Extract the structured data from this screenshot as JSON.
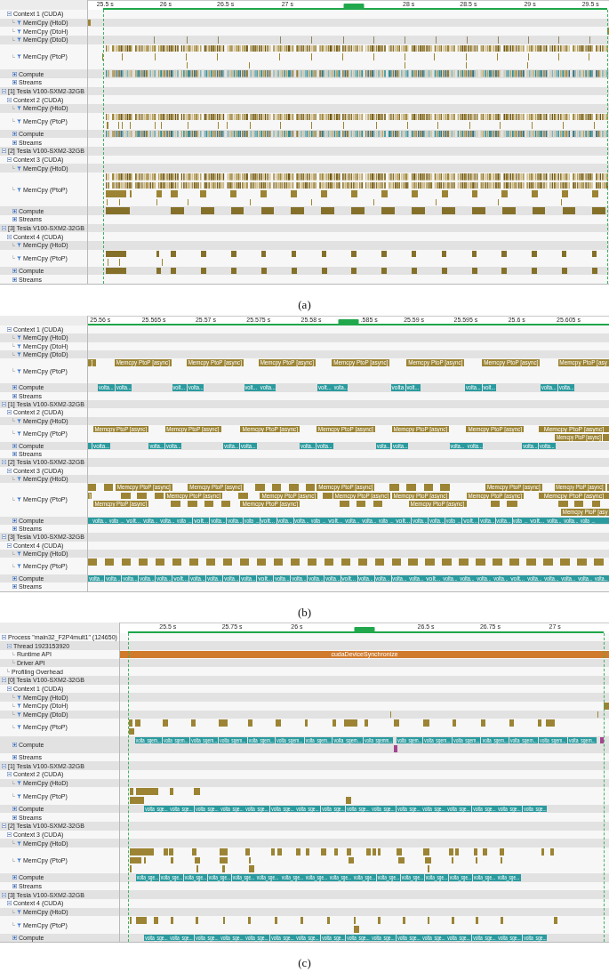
{
  "panels": [
    {
      "caption": "(a)",
      "ticks": [
        "25.5 s",
        "26 s",
        "26.5 s",
        "27 s",
        "28 s",
        "28.5 s",
        "29 s",
        "29.5 s"
      ],
      "rows": [
        {
          "label": "Context 1 (CUDA)",
          "kind": "context",
          "expanded": true,
          "children": [
            {
              "label": "MemCpy (HtoD)",
              "kind": "memcpy"
            },
            {
              "label": "MemCpy (DtoH)",
              "kind": "memcpy"
            },
            {
              "label": "MemCpy (DtoD)",
              "kind": "memcpy"
            },
            {
              "label": "MemCpy (PtoP)",
              "kind": "memcpy"
            },
            {
              "label": "Compute",
              "kind": "compute",
              "expanded": false
            },
            {
              "label": "Streams",
              "kind": "streams",
              "expanded": false
            }
          ]
        },
        {
          "label": "[1] Tesla V100-SXM2-32GB",
          "kind": "device",
          "expanded": true,
          "children": [
            {
              "label": "Context 2 (CUDA)",
              "kind": "context",
              "expanded": true,
              "children": [
                {
                  "label": "MemCpy (HtoD)",
                  "kind": "memcpy"
                },
                {
                  "label": "MemCpy (PtoP)",
                  "kind": "memcpy"
                },
                {
                  "label": "Compute",
                  "kind": "compute",
                  "expanded": false
                },
                {
                  "label": "Streams",
                  "kind": "streams",
                  "expanded": false
                }
              ]
            }
          ]
        },
        {
          "label": "[2] Tesla V100-SXM2-32GB",
          "kind": "device",
          "expanded": true,
          "children": [
            {
              "label": "Context 3 (CUDA)",
              "kind": "context",
              "expanded": true,
              "children": [
                {
                  "label": "MemCpy (HtoD)",
                  "kind": "memcpy"
                },
                {
                  "label": "MemCpy (PtoP)",
                  "kind": "memcpy"
                },
                {
                  "label": "Compute",
                  "kind": "compute",
                  "expanded": false
                },
                {
                  "label": "Streams",
                  "kind": "streams",
                  "expanded": false
                }
              ]
            }
          ]
        },
        {
          "label": "[3] Tesla V100-SXM2-32GB",
          "kind": "device",
          "expanded": true,
          "children": [
            {
              "label": "Context 4 (CUDA)",
              "kind": "context",
              "expanded": true,
              "children": [
                {
                  "label": "MemCpy (HtoD)",
                  "kind": "memcpy"
                },
                {
                  "label": "MemCpy (PtoP)",
                  "kind": "memcpy"
                },
                {
                  "label": "Compute",
                  "kind": "compute",
                  "expanded": false
                },
                {
                  "label": "Streams",
                  "kind": "streams",
                  "expanded": false
                }
              ]
            }
          ]
        }
      ]
    },
    {
      "caption": "(b)",
      "ticks": [
        "25.56 s",
        "25.565 s",
        "25.57 s",
        "25.575 s",
        "25.58 s",
        ".585 s",
        "25.59 s",
        "25.595 s",
        "25.6 s",
        "25.605 s"
      ],
      "rows": [
        {
          "label": "Context 1 (CUDA)",
          "kind": "context",
          "expanded": true,
          "children": [
            {
              "label": "MemCpy (HtoD)",
              "kind": "memcpy"
            },
            {
              "label": "MemCpy (DtoH)",
              "kind": "memcpy"
            },
            {
              "label": "MemCpy (DtoD)",
              "kind": "memcpy"
            },
            {
              "label": "MemCpy (PtoP)",
              "kind": "memcpy",
              "bar_labels": [
                "]",
                "Memcpy PtoP [async]",
                "Memcpy PtoP [async]",
                "Memcpy PtoP [async]",
                "Memcpy PtoP [async]",
                "Memcpy PtoP [async]",
                "Memcpy PtoP [async]",
                "Memcpy PtoP [asy"
              ]
            },
            {
              "label": "Compute",
              "kind": "compute",
              "expanded": false,
              "bar_labels": [
                "volta...",
                "volta...",
                "volt...",
                "volta...",
                "volt...",
                "volta...",
                "volt...",
                "volta...",
                "volta",
                "volt...",
                "volta...",
                "volt...",
                "volta...",
                "volta..."
              ]
            },
            {
              "label": "Streams",
              "kind": "streams",
              "expanded": false
            }
          ]
        },
        {
          "label": "[1] Tesla V100-SXM2-32GB",
          "kind": "device",
          "expanded": true,
          "children": [
            {
              "label": "Context 2 (CUDA)",
              "kind": "context",
              "expanded": true,
              "children": [
                {
                  "label": "MemCpy (HtoD)",
                  "kind": "memcpy"
                },
                {
                  "label": "MemCpy (PtoP)",
                  "kind": "memcpy",
                  "bar_labels": [
                    "Memcpy PtoP [async]",
                    "Memcpy PtoP [async]",
                    "Memcpy PtoP [async]",
                    "Memcpy PtoP [async]",
                    "Memcpy PtoP [async]",
                    "Memcpy PtoP [async]",
                    "Memcpy PtoP [async]",
                    "Memcpy PtoP [async]"
                  ]
                },
                {
                  "label": "Compute",
                  "kind": "compute",
                  "expanded": false,
                  "bar_labels": [
                    "volta...",
                    "volta...",
                    "volta...",
                    "volta...",
                    "volta...",
                    "volta...",
                    "volta...",
                    "volta...",
                    "volta...",
                    "volta...",
                    "volta...",
                    "volta...",
                    "volta..."
                  ]
                },
                {
                  "label": "Streams",
                  "kind": "streams",
                  "expanded": false
                }
              ]
            }
          ]
        },
        {
          "label": "[2] Tesla V100-SXM2-32GB",
          "kind": "device",
          "expanded": true,
          "children": [
            {
              "label": "Context 3 (CUDA)",
              "kind": "context",
              "expanded": true,
              "children": [
                {
                  "label": "MemCpy (HtoD)",
                  "kind": "memcpy"
                },
                {
                  "label": "MemCpy (PtoP)",
                  "kind": "memcpy",
                  "bar_labels": [
                    "Memcpy PtoP [async]",
                    "Memcpy PtoP [async]",
                    "Memcpy PtoP [async]",
                    "Memcpy PtoP [async]",
                    "Memcpy PtoP [async]",
                    "]",
                    "Memcpy PtoP [async]",
                    "Memcpy PtoP [async]",
                    "Memcpy PtoP [async]",
                    "Memcpy PtoP [async]",
                    "Memcpy PtoP [async]",
                    "Memcpy PtoP [async]",
                    "Memcpy PtoP [async]",
                    "Memcpy PtoP [async]",
                    "Memcpy PtoP [async]",
                    "Memcpy PtoP [asy"
                  ]
                },
                {
                  "label": "Compute",
                  "kind": "compute",
                  "expanded": false,
                  "bar_labels": [
                    "volta...",
                    "volta_...",
                    "volt...",
                    "volta...",
                    "volta...",
                    "volta_...",
                    "volt...",
                    "volta...",
                    "volta...",
                    "volta_...",
                    "volt...",
                    "volta...",
                    "volta...",
                    "volta_...",
                    "volt...",
                    "volta...",
                    "volta...",
                    "volta_...",
                    "volt...",
                    "volta...",
                    "volta...",
                    "volta_...",
                    "volt...",
                    "volta...",
                    "volta...",
                    "volta_...",
                    "volt...",
                    "volta...",
                    "volta...",
                    "volta_..."
                  ]
                },
                {
                  "label": "Streams",
                  "kind": "streams",
                  "expanded": false
                }
              ]
            }
          ]
        },
        {
          "label": "[3] Tesla V100-SXM2-32GB",
          "kind": "device",
          "expanded": true,
          "children": [
            {
              "label": "Context 4 (CUDA)",
              "kind": "context",
              "expanded": true,
              "children": [
                {
                  "label": "MemCpy (HtoD)",
                  "kind": "memcpy"
                },
                {
                  "label": "MemCpy (PtoP)",
                  "kind": "memcpy"
                },
                {
                  "label": "Compute",
                  "kind": "compute",
                  "expanded": false,
                  "bar_labels": [
                    "volta...",
                    "volta...",
                    "volta...",
                    "volta...",
                    "volta...",
                    "volt...",
                    "volta...",
                    "volta...",
                    "volta...",
                    "volta...",
                    "volt...",
                    "volta...",
                    "volta...",
                    "volta...",
                    "volta...",
                    "volt...",
                    "volta...",
                    "volta...",
                    "volta...",
                    "volta...",
                    "volt...",
                    "volta...",
                    "volta...",
                    "volta...",
                    "volta...",
                    "volt...",
                    "volta...",
                    "volta...",
                    "volta...",
                    "volta...",
                    "volta..."
                  ]
                },
                {
                  "label": "Streams",
                  "kind": "streams",
                  "expanded": false
                }
              ]
            }
          ]
        }
      ]
    },
    {
      "caption": "(c)",
      "ticks": [
        "25.5 s",
        "25.75 s",
        "26 s",
        "26.5 s",
        "26.75 s",
        "27 s"
      ],
      "rows": [
        {
          "label": "Process \"main32_F2P4mult1\" (124650)",
          "kind": "process",
          "expanded": true,
          "children": [
            {
              "label": "Thread 1923153920",
              "kind": "thread",
              "expanded": true,
              "children": [
                {
                  "label": "Runtime API",
                  "kind": "api",
                  "bar_labels": [
                    "cudaDeviceSynchronize"
                  ]
                },
                {
                  "label": "Driver API",
                  "kind": "api"
                }
              ]
            },
            {
              "label": "Profiling Overhead",
              "kind": "overhead"
            }
          ]
        },
        {
          "label": "[0] Tesla V100-SXM2-32GB",
          "kind": "device",
          "expanded": true,
          "children": [
            {
              "label": "Context 1 (CUDA)",
              "kind": "context",
              "expanded": true,
              "children": [
                {
                  "label": "MemCpy (HtoD)",
                  "kind": "memcpy"
                },
                {
                  "label": "MemCpy (DtoH)",
                  "kind": "memcpy"
                },
                {
                  "label": "MemCpy (DtoD)",
                  "kind": "memcpy"
                },
                {
                  "label": "MemCpy (PtoP)",
                  "kind": "memcpy"
                },
                {
                  "label": "Compute",
                  "kind": "compute",
                  "expanded": false,
                  "bar_labels": [
                    "volta_sgem...",
                    "volta_sgem...",
                    "volta_sgem...",
                    "volta_sgem...",
                    "volta_sgem...",
                    "volta_sgem...",
                    "volta_sgem...",
                    "volta_sgem...",
                    "volta_sgemm...",
                    "volta_sgem...",
                    "volta_sgem...",
                    "volta_sgem...",
                    "volta_sgem...",
                    "volta_sgem...",
                    "volta_sgem...",
                    "volta_sgem..."
                  ]
                },
                {
                  "label": "Streams",
                  "kind": "streams",
                  "expanded": false
                }
              ]
            }
          ]
        },
        {
          "label": "[1] Tesla V100-SXM2-32GB",
          "kind": "device",
          "expanded": true,
          "children": [
            {
              "label": "Context 2 (CUDA)",
              "kind": "context",
              "expanded": true,
              "children": [
                {
                  "label": "MemCpy (HtoD)",
                  "kind": "memcpy"
                },
                {
                  "label": "MemCpy (PtoP)",
                  "kind": "memcpy"
                },
                {
                  "label": "Compute",
                  "kind": "compute",
                  "expanded": false,
                  "bar_labels": [
                    "volta_sge...",
                    "volta_sge...",
                    "volta_sge...",
                    "volta_sge...",
                    "volta_sge...",
                    "volta_sge...",
                    "volta_sge...",
                    "volta_sge...",
                    "volta_sge...",
                    "volta_sge...",
                    "volta_sge...",
                    "volta_sge...",
                    "volta_sge...",
                    "volta_sge...",
                    "volta_sge...",
                    "volta_sge..."
                  ]
                },
                {
                  "label": "Streams",
                  "kind": "streams",
                  "expanded": false
                }
              ]
            }
          ]
        },
        {
          "label": "[2] Tesla V100-SXM2-32GB",
          "kind": "device",
          "expanded": true,
          "children": [
            {
              "label": "Context 3 (CUDA)",
              "kind": "context",
              "expanded": true,
              "children": [
                {
                  "label": "MemCpy (HtoD)",
                  "kind": "memcpy"
                },
                {
                  "label": "MemCpy (PtoP)",
                  "kind": "memcpy"
                },
                {
                  "label": "Compute",
                  "kind": "compute",
                  "expanded": false,
                  "bar_labels": [
                    "volta_sge...",
                    "volta_sge...",
                    "volta_sge...",
                    "volta_sge...",
                    "volta_sge...",
                    "volta_sge...",
                    "volta_sge...",
                    "volta_sge...",
                    "volta_sge...",
                    "volta_sge...",
                    "volta_sge...",
                    "volta_sge...",
                    "volta_sge...",
                    "volta_sge...",
                    "volta_sge...",
                    "volta_sge..."
                  ]
                },
                {
                  "label": "Streams",
                  "kind": "streams",
                  "expanded": false
                }
              ]
            }
          ]
        },
        {
          "label": "[3] Tesla V100-SXM2-32GB",
          "kind": "device",
          "expanded": true,
          "children": [
            {
              "label": "Context 4 (CUDA)",
              "kind": "context",
              "expanded": true,
              "children": [
                {
                  "label": "MemCpy (HtoD)",
                  "kind": "memcpy"
                },
                {
                  "label": "MemCpy (PtoP)",
                  "kind": "memcpy"
                },
                {
                  "label": "Compute",
                  "kind": "compute",
                  "expanded": false,
                  "bar_labels": [
                    "volta_sge...",
                    "volta_sge...",
                    "volta_sge...",
                    "volta_sge...",
                    "volta_sge...",
                    "volta_sge...",
                    "volta_sge...",
                    "volta_sge...",
                    "volta_sge...",
                    "volta_sge...",
                    "volta_sge...",
                    "volta_sge...",
                    "volta_sge...",
                    "volta_sge...",
                    "volta_sge...",
                    "volta_sge..."
                  ]
                }
              ]
            }
          ]
        }
      ]
    }
  ]
}
